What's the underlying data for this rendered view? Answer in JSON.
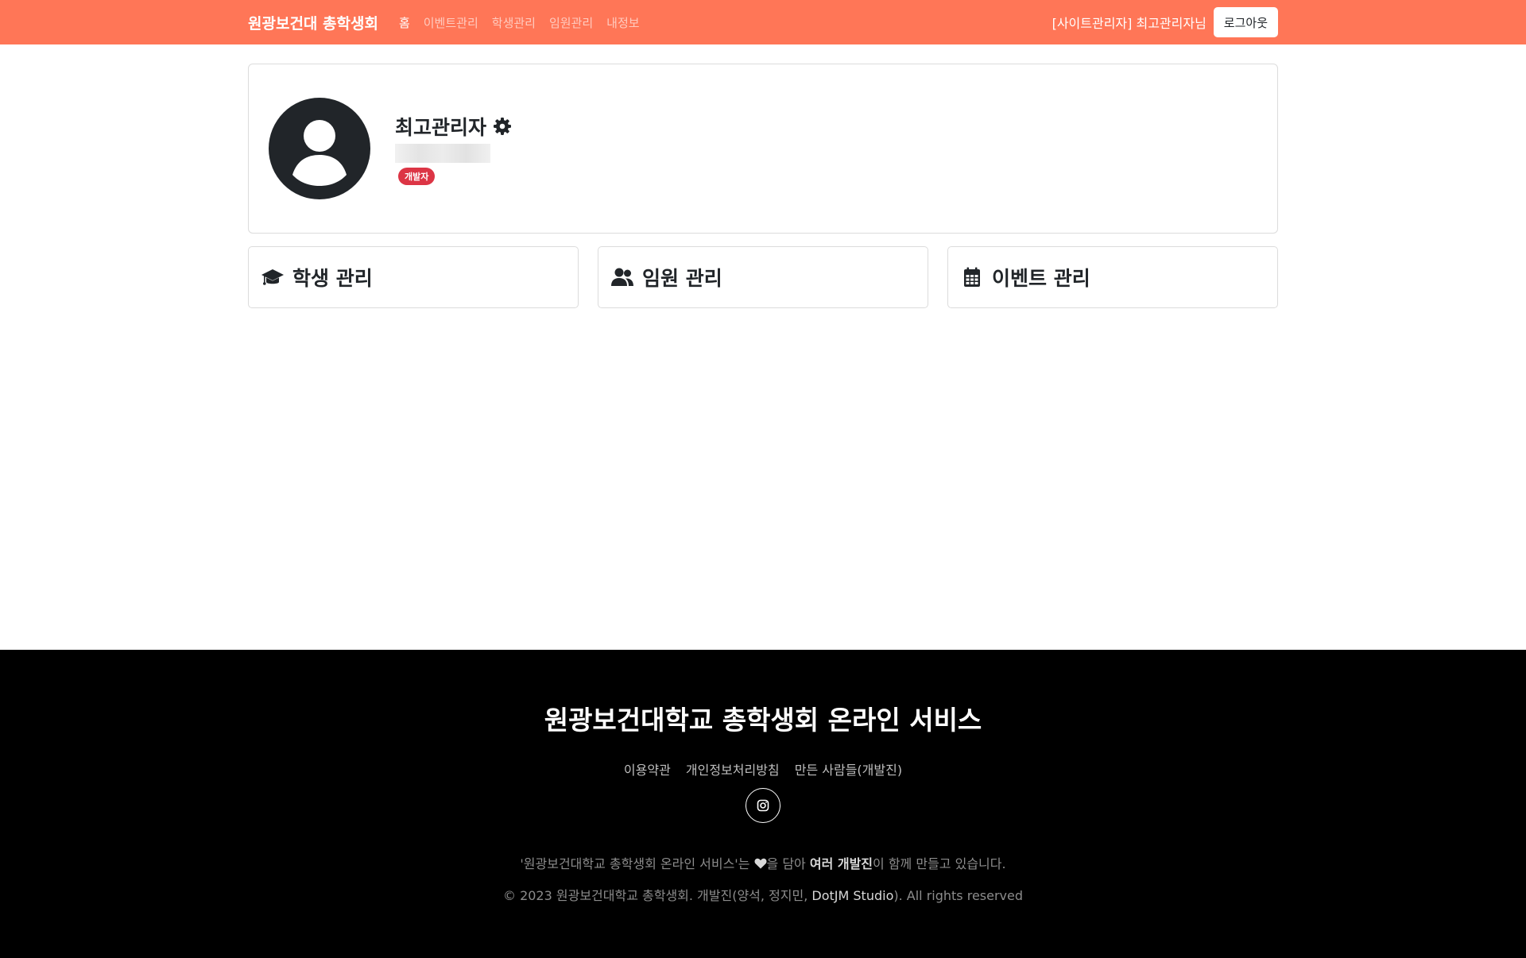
{
  "nav": {
    "brand": "원광보건대 총학생회",
    "links": [
      {
        "label": "홈"
      },
      {
        "label": "이벤트관리"
      },
      {
        "label": "학생관리"
      },
      {
        "label": "임원관리"
      },
      {
        "label": "내정보"
      }
    ],
    "user_text": "[사이트관리자] 최고관리자님",
    "logout_label": "로그아웃",
    "bg_color": "#ff7657"
  },
  "profile": {
    "name": "최고관리자",
    "badge": "개발자",
    "badge_color": "#dc3545",
    "avatar_icon": "user-circle-icon",
    "settings_icon": "gear-icon"
  },
  "management": [
    {
      "title": "학생 관리",
      "icon": "graduation-cap-icon"
    },
    {
      "title": "임원 관리",
      "icon": "users-icon"
    },
    {
      "title": "이벤트 관리",
      "icon": "calendar-icon"
    }
  ],
  "footer": {
    "title": "원광보건대학교 총학생회 온라인 서비스",
    "links": [
      {
        "label": "이용약관"
      },
      {
        "label": "개인정보처리방침"
      },
      {
        "label": "만든 사람들(개발진)"
      }
    ],
    "social_icon": "instagram-icon",
    "credit": {
      "before": "'원광보건대학교 총학생회 온라인 서비스'는 ",
      "heart_icon": "heart-icon",
      "middle": "을 담아 ",
      "highlight": "여러 개발진",
      "after": "이 함께 만들고 있습니다."
    },
    "copyright": {
      "before": "© 2023 원광보건대학교 총학생회. 개발진(양석, 정지민, ",
      "highlight": "DotJM Studio",
      "after": "). All rights reserved"
    }
  }
}
